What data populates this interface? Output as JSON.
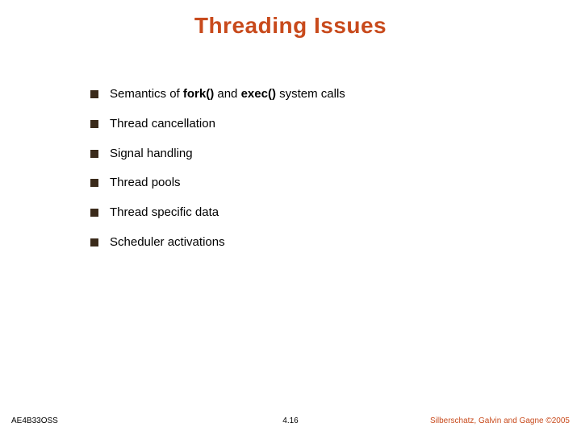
{
  "title": "Threading Issues",
  "items": [
    {
      "prefix": "Semantics of ",
      "bold1": "fork()",
      "mid": " and ",
      "bold2": "exec()",
      "suffix": " system calls"
    },
    {
      "plain": "Thread cancellation"
    },
    {
      "plain": "Signal handling"
    },
    {
      "plain": "Thread pools"
    },
    {
      "plain": "Thread specific data"
    },
    {
      "plain": "Scheduler activations"
    }
  ],
  "footer": {
    "left": "AE4B33OSS",
    "center": "4.16",
    "right": "Silberschatz, Galvin and Gagne ©2005"
  }
}
